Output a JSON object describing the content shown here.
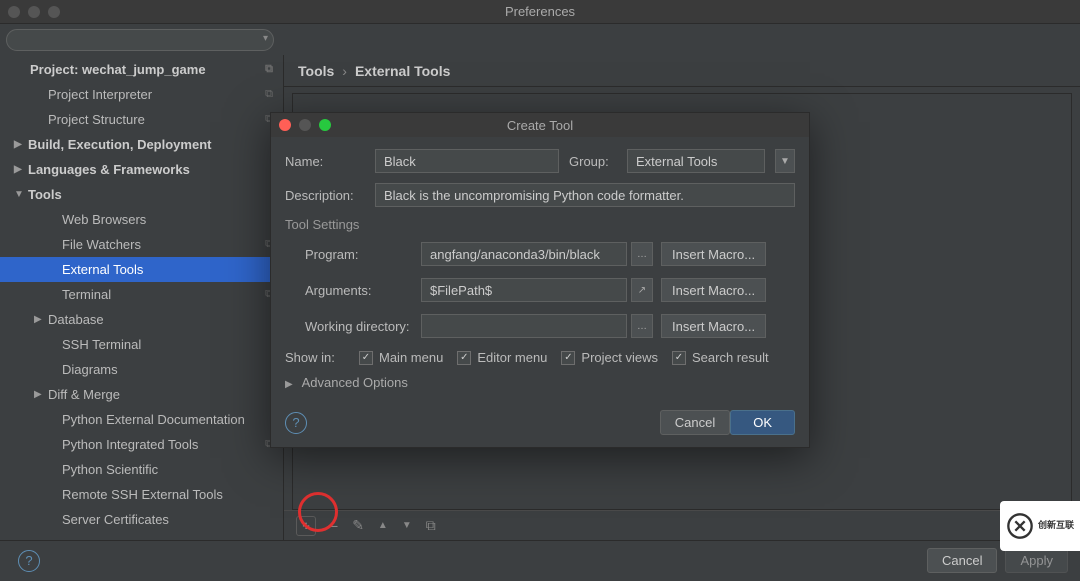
{
  "window": {
    "title": "Preferences"
  },
  "search": {
    "placeholder": ""
  },
  "breadcrumb": {
    "root": "Tools",
    "leaf": "External Tools"
  },
  "sidebar": {
    "project_label": "Project: wechat_jump_game",
    "project_items": [
      {
        "label": "Project Interpreter",
        "copy": true
      },
      {
        "label": "Project Structure",
        "copy": true
      }
    ],
    "sections": [
      {
        "label": "Build, Execution, Deployment",
        "expanded": false
      },
      {
        "label": "Languages & Frameworks",
        "expanded": false
      }
    ],
    "tools_label": "Tools",
    "tools_items": [
      {
        "label": "Web Browsers"
      },
      {
        "label": "File Watchers",
        "copy": true
      },
      {
        "label": "External Tools",
        "selected": true
      },
      {
        "label": "Terminal",
        "copy": true
      },
      {
        "label": "Database",
        "arrow": true
      },
      {
        "label": "SSH Terminal"
      },
      {
        "label": "Diagrams"
      },
      {
        "label": "Diff & Merge",
        "arrow": true
      },
      {
        "label": "Python External Documentation"
      },
      {
        "label": "Python Integrated Tools",
        "copy": true
      },
      {
        "label": "Python Scientific"
      },
      {
        "label": "Remote SSH External Tools"
      },
      {
        "label": "Server Certificates"
      }
    ]
  },
  "toolbar": {
    "add": "+",
    "remove": "−",
    "edit": "✎",
    "up": "▲",
    "down": "▼",
    "copy": "⧉"
  },
  "footer": {
    "cancel": "Cancel",
    "apply": "Apply"
  },
  "dialog": {
    "title": "Create Tool",
    "name_label": "Name:",
    "name_value": "Black",
    "group_label": "Group:",
    "group_value": "External Tools",
    "desc_label": "Description:",
    "desc_value": "Black is the uncompromising Python code formatter.",
    "tool_settings": "Tool Settings",
    "program_label": "Program:",
    "program_value": "angfang/anaconda3/bin/black",
    "arguments_label": "Arguments:",
    "arguments_value": "$FilePath$",
    "workdir_label": "Working directory:",
    "workdir_value": "",
    "insert_macro": "Insert Macro...",
    "showin_label": "Show in:",
    "showin_options": [
      {
        "label": "Main menu",
        "checked": true
      },
      {
        "label": "Editor menu",
        "checked": true
      },
      {
        "label": "Project views",
        "checked": true
      },
      {
        "label": "Search result",
        "checked": true
      }
    ],
    "advanced": "Advanced Options",
    "cancel": "Cancel",
    "ok": "OK"
  },
  "watermark": {
    "text": "创新互联"
  }
}
